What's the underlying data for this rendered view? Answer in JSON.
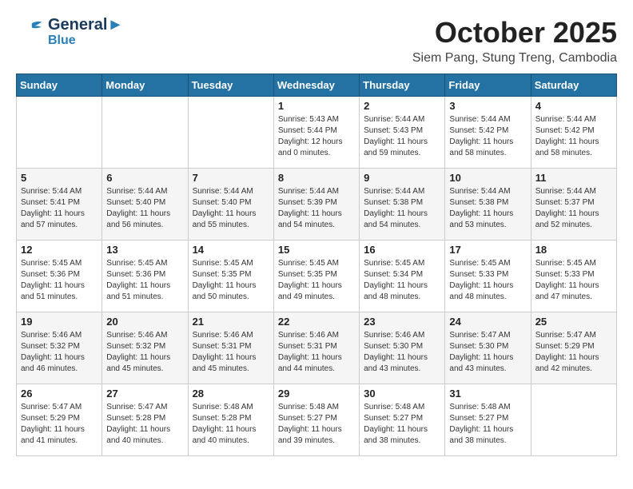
{
  "header": {
    "logo_line1": "General",
    "logo_line2": "Blue",
    "month": "October 2025",
    "location": "Siem Pang, Stung Treng, Cambodia"
  },
  "weekdays": [
    "Sunday",
    "Monday",
    "Tuesday",
    "Wednesday",
    "Thursday",
    "Friday",
    "Saturday"
  ],
  "weeks": [
    [
      {
        "day": "",
        "info": ""
      },
      {
        "day": "",
        "info": ""
      },
      {
        "day": "",
        "info": ""
      },
      {
        "day": "1",
        "info": "Sunrise: 5:43 AM\nSunset: 5:44 PM\nDaylight: 12 hours\nand 0 minutes."
      },
      {
        "day": "2",
        "info": "Sunrise: 5:44 AM\nSunset: 5:43 PM\nDaylight: 11 hours\nand 59 minutes."
      },
      {
        "day": "3",
        "info": "Sunrise: 5:44 AM\nSunset: 5:42 PM\nDaylight: 11 hours\nand 58 minutes."
      },
      {
        "day": "4",
        "info": "Sunrise: 5:44 AM\nSunset: 5:42 PM\nDaylight: 11 hours\nand 58 minutes."
      }
    ],
    [
      {
        "day": "5",
        "info": "Sunrise: 5:44 AM\nSunset: 5:41 PM\nDaylight: 11 hours\nand 57 minutes."
      },
      {
        "day": "6",
        "info": "Sunrise: 5:44 AM\nSunset: 5:40 PM\nDaylight: 11 hours\nand 56 minutes."
      },
      {
        "day": "7",
        "info": "Sunrise: 5:44 AM\nSunset: 5:40 PM\nDaylight: 11 hours\nand 55 minutes."
      },
      {
        "day": "8",
        "info": "Sunrise: 5:44 AM\nSunset: 5:39 PM\nDaylight: 11 hours\nand 54 minutes."
      },
      {
        "day": "9",
        "info": "Sunrise: 5:44 AM\nSunset: 5:38 PM\nDaylight: 11 hours\nand 54 minutes."
      },
      {
        "day": "10",
        "info": "Sunrise: 5:44 AM\nSunset: 5:38 PM\nDaylight: 11 hours\nand 53 minutes."
      },
      {
        "day": "11",
        "info": "Sunrise: 5:44 AM\nSunset: 5:37 PM\nDaylight: 11 hours\nand 52 minutes."
      }
    ],
    [
      {
        "day": "12",
        "info": "Sunrise: 5:45 AM\nSunset: 5:36 PM\nDaylight: 11 hours\nand 51 minutes."
      },
      {
        "day": "13",
        "info": "Sunrise: 5:45 AM\nSunset: 5:36 PM\nDaylight: 11 hours\nand 51 minutes."
      },
      {
        "day": "14",
        "info": "Sunrise: 5:45 AM\nSunset: 5:35 PM\nDaylight: 11 hours\nand 50 minutes."
      },
      {
        "day": "15",
        "info": "Sunrise: 5:45 AM\nSunset: 5:35 PM\nDaylight: 11 hours\nand 49 minutes."
      },
      {
        "day": "16",
        "info": "Sunrise: 5:45 AM\nSunset: 5:34 PM\nDaylight: 11 hours\nand 48 minutes."
      },
      {
        "day": "17",
        "info": "Sunrise: 5:45 AM\nSunset: 5:33 PM\nDaylight: 11 hours\nand 48 minutes."
      },
      {
        "day": "18",
        "info": "Sunrise: 5:45 AM\nSunset: 5:33 PM\nDaylight: 11 hours\nand 47 minutes."
      }
    ],
    [
      {
        "day": "19",
        "info": "Sunrise: 5:46 AM\nSunset: 5:32 PM\nDaylight: 11 hours\nand 46 minutes."
      },
      {
        "day": "20",
        "info": "Sunrise: 5:46 AM\nSunset: 5:32 PM\nDaylight: 11 hours\nand 45 minutes."
      },
      {
        "day": "21",
        "info": "Sunrise: 5:46 AM\nSunset: 5:31 PM\nDaylight: 11 hours\nand 45 minutes."
      },
      {
        "day": "22",
        "info": "Sunrise: 5:46 AM\nSunset: 5:31 PM\nDaylight: 11 hours\nand 44 minutes."
      },
      {
        "day": "23",
        "info": "Sunrise: 5:46 AM\nSunset: 5:30 PM\nDaylight: 11 hours\nand 43 minutes."
      },
      {
        "day": "24",
        "info": "Sunrise: 5:47 AM\nSunset: 5:30 PM\nDaylight: 11 hours\nand 43 minutes."
      },
      {
        "day": "25",
        "info": "Sunrise: 5:47 AM\nSunset: 5:29 PM\nDaylight: 11 hours\nand 42 minutes."
      }
    ],
    [
      {
        "day": "26",
        "info": "Sunrise: 5:47 AM\nSunset: 5:29 PM\nDaylight: 11 hours\nand 41 minutes."
      },
      {
        "day": "27",
        "info": "Sunrise: 5:47 AM\nSunset: 5:28 PM\nDaylight: 11 hours\nand 40 minutes."
      },
      {
        "day": "28",
        "info": "Sunrise: 5:48 AM\nSunset: 5:28 PM\nDaylight: 11 hours\nand 40 minutes."
      },
      {
        "day": "29",
        "info": "Sunrise: 5:48 AM\nSunset: 5:27 PM\nDaylight: 11 hours\nand 39 minutes."
      },
      {
        "day": "30",
        "info": "Sunrise: 5:48 AM\nSunset: 5:27 PM\nDaylight: 11 hours\nand 38 minutes."
      },
      {
        "day": "31",
        "info": "Sunrise: 5:48 AM\nSunset: 5:27 PM\nDaylight: 11 hours\nand 38 minutes."
      },
      {
        "day": "",
        "info": ""
      }
    ]
  ]
}
